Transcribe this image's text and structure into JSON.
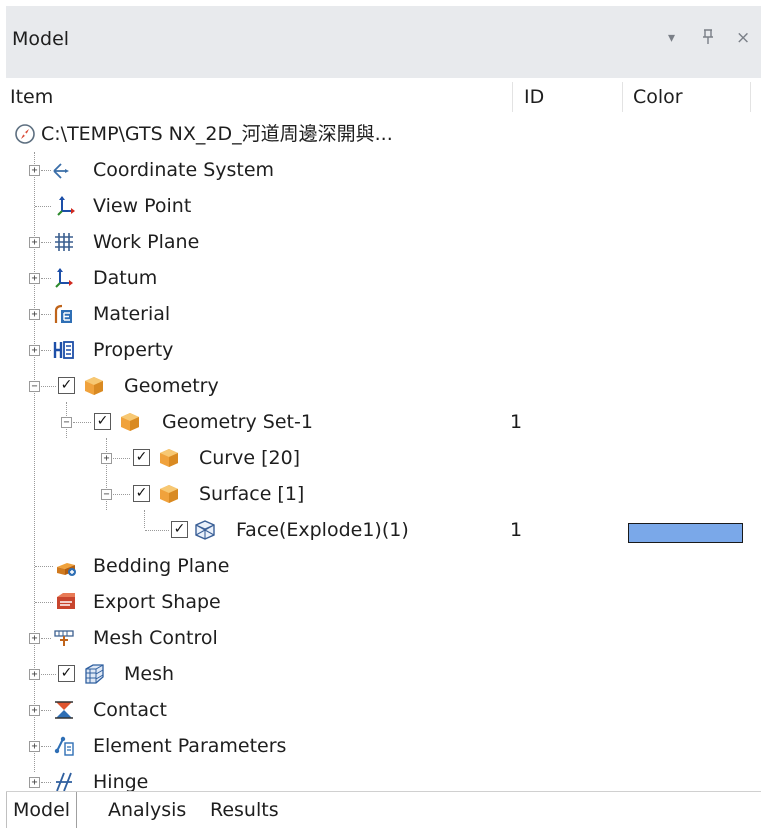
{
  "panel": {
    "title": "Model",
    "dropdown_glyph": "▾",
    "pin_glyph": "⊥",
    "close_glyph": "×"
  },
  "columns": {
    "item": "Item",
    "id": "ID",
    "color": "Color"
  },
  "root": {
    "label": "C:\\TEMP\\GTS NX_2D_河道周邊深開與...",
    "icon": "compass-icon"
  },
  "tree": {
    "coordinate_system": "Coordinate System",
    "view_point": "View Point",
    "work_plane": "Work Plane",
    "datum": "Datum",
    "material": "Material",
    "property": "Property",
    "geometry": "Geometry",
    "geometry_set": {
      "label": "Geometry Set-1",
      "id": "1"
    },
    "curve": "Curve [20]",
    "surface": "Surface [1]",
    "face": {
      "label": "Face(Explode1)(1)",
      "id": "1",
      "color": "#7aa8e9"
    },
    "bedding_plane": "Bedding Plane",
    "export_shape": "Export Shape",
    "mesh_control": "Mesh Control",
    "mesh": "Mesh",
    "contact": "Contact",
    "element_parameters": "Element Parameters",
    "hinge": "Hinge"
  },
  "expander": {
    "plus": "+",
    "minus": "−"
  },
  "check_mark": "✓",
  "tabs": {
    "model": "Model",
    "analysis": "Analysis",
    "results": "Results"
  }
}
